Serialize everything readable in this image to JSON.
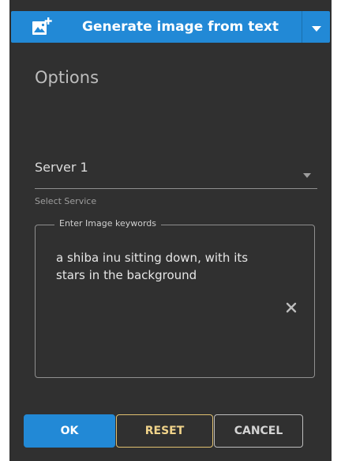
{
  "header": {
    "title": "Generate image from text",
    "icon": "add-image-icon",
    "dropdown_icon": "chevron-down-icon",
    "color": "#2289d6"
  },
  "options": {
    "title": "Options"
  },
  "service_select": {
    "value": "Server 1",
    "caption": "Select Service",
    "icon": "dropdown-arrow-icon"
  },
  "keywords_field": {
    "label": "Enter Image keywords",
    "value": "a shiba inu sitting down, with its stars in the background",
    "clear_icon": "clear-icon"
  },
  "buttons": {
    "ok_label": "OK",
    "reset_label": "RESET",
    "cancel_label": "CANCEL"
  },
  "colors": {
    "panel_background": "#303030",
    "accent": "#2289d6",
    "reset_accent": "#e0c070"
  }
}
